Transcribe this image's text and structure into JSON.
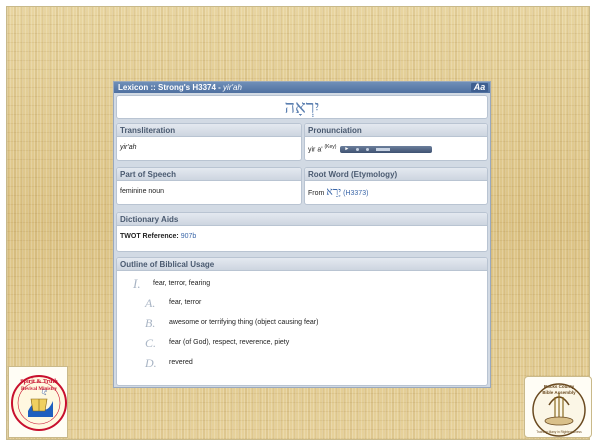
{
  "lexicon": {
    "title_prefix": "Lexicon :: Strong's H3374 - ",
    "title_word": "yir'ah",
    "font_toggle": "Aa",
    "hebrew_word": "יִרְאָה"
  },
  "transliteration": {
    "label": "Transliteration",
    "value": "yir'ah"
  },
  "pronunciation": {
    "label": "Pronunciation",
    "value": "yir a'",
    "key_label": "(Key)",
    "play_symbol": "►"
  },
  "part_of_speech": {
    "label": "Part of Speech",
    "value": "feminine noun"
  },
  "root_word": {
    "label": "Root Word (Etymology)",
    "prefix": "From ",
    "hebrew": "יָרֵא",
    "ref": "(H3373)"
  },
  "dictionary_aids": {
    "label": "Dictionary Aids",
    "twot_label": "TWOT Reference: ",
    "twot_value": "907b"
  },
  "outline": {
    "label": "Outline of Biblical Usage",
    "main": {
      "marker": "I.",
      "text": "fear, terror, fearing"
    },
    "subs": [
      {
        "marker": "A.",
        "text": "fear, terror"
      },
      {
        "marker": "B.",
        "text": "awesome or terrifying thing (object causing fear)"
      },
      {
        "marker": "C.",
        "text": "fear (of God), respect, reverence, piety"
      },
      {
        "marker": "D.",
        "text": "revered"
      }
    ]
  },
  "logos": {
    "left": {
      "line1": "Spirit & Truth",
      "line2": "Revival Ministry"
    },
    "right": {
      "line1": "Bucks County",
      "line2": "Bible Assembly",
      "line3": "Training Many in Righteousness"
    }
  }
}
